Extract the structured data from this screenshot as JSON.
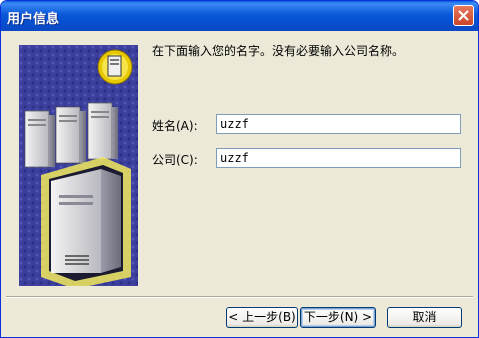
{
  "window": {
    "title": "用户信息"
  },
  "instruction": "在下面输入您的名字。没有必要输入公司名称。",
  "fields": {
    "name": {
      "label": "姓名(A):",
      "value": "uzzf"
    },
    "company": {
      "label": "公司(C):",
      "value": "uzzf"
    }
  },
  "buttons": {
    "back": "< 上一步(B)",
    "next": "下一步(N) >",
    "cancel": "取消"
  },
  "colors": {
    "titlebar": "#0a58d8",
    "art_background": "#3b3fa0",
    "server_glow": "#f2ea5c"
  }
}
